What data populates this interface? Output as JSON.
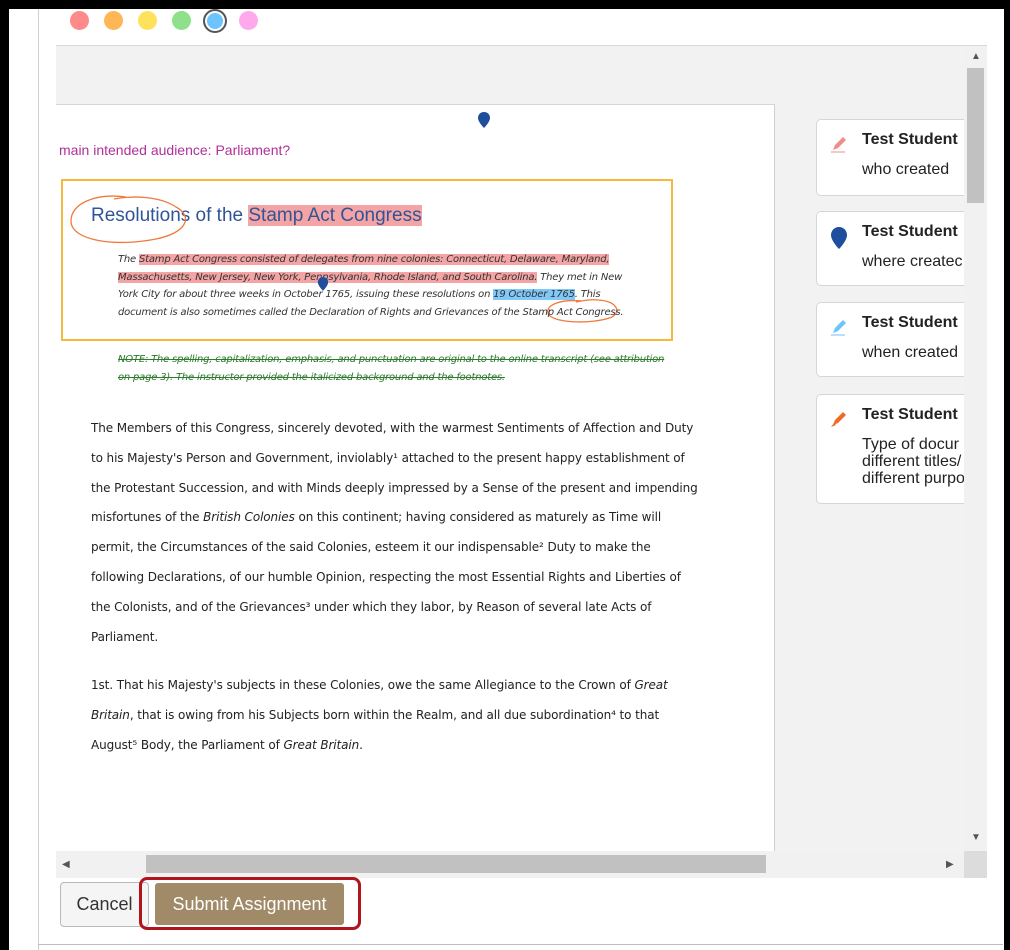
{
  "color_palette": [
    {
      "name": "red",
      "hex": "#ff8a8a"
    },
    {
      "name": "orange",
      "hex": "#ffb655"
    },
    {
      "name": "yellow",
      "hex": "#ffe25c"
    },
    {
      "name": "green",
      "hex": "#8fe08a"
    },
    {
      "name": "blue",
      "hex": "#6cc4ff",
      "selected": true
    },
    {
      "name": "pink",
      "hex": "#ffa8ec"
    }
  ],
  "document": {
    "annotation_comment": "main intended audience: Parliament?",
    "title_plain": "Resolutions of the ",
    "title_highlight": "Stamp Act Congress",
    "intro_prefix": "The ",
    "intro_hl_red": "Stamp Act Congress consisted of delegates from nine colonies: Connecticut, Delaware, Maryland, Massachusetts, New Jersey, New York, Pennsylvania, Rhode Island, and South Carolina.",
    "intro_mid": "  They met in New York City for about three weeks in October 1765, issuing these resolutions on ",
    "intro_hl_blue": "19 October 1765",
    "intro_end": ". This document is also sometimes called the Declaration of Rights and Grievances of the Stamp Act Congress.",
    "note": "NOTE: The spelling, capitalization, emphasis, and punctuation are original to the online transcript (see attribution on page 3). The instructor provided the italicized background and the footnotes.",
    "para1_a": "The Members of this Congress, sincerely devoted, with the warmest Sentiments of Affection and Duty to his Majesty's Person and Government, inviolably¹ attached to the present happy establishment of the Protestant Succession, and with Minds deeply impressed by a Sense of the present and impending misfortunes of the ",
    "para1_ital": "British Colonies",
    "para1_b": " on this continent; having considered as maturely as Time will permit, the Circumstances of the said Colonies, esteem it our indispensable² Duty to make the following Declarations, of our humble Opinion, respecting the most Essential Rights and Liberties of the Colonists, and of the Grievances³ under which they labor, by Reason of several late Acts of Parliament.",
    "para2_a": "1st. That his Majesty's subjects in these Colonies, owe the same Allegiance to the Crown of ",
    "para2_ital1": "Great Britain",
    "para2_b": ", that is owing from his Subjects born within the Realm, and all due subordination⁴ to that August⁵ Body, the Parliament of ",
    "para2_ital2": "Great Britain",
    "para2_c": "."
  },
  "annotations": [
    {
      "author": "Test Student",
      "text": "who created",
      "icon": "pencil-icon",
      "color": "#f28b8b"
    },
    {
      "author": "Test Student",
      "text": "where createc",
      "icon": "map-pin-icon",
      "color": "#1f4e9c"
    },
    {
      "author": "Test Student",
      "text": "when created",
      "icon": "pencil-icon",
      "color": "#6cc4ff"
    },
    {
      "author": "Test Student",
      "text": "Type of docur\ndifferent titles/\ndifferent purpo",
      "icon": "pencil-icon",
      "color": "#f06a28"
    }
  ],
  "buttons": {
    "cancel": "Cancel",
    "submit": "Submit Assignment"
  }
}
